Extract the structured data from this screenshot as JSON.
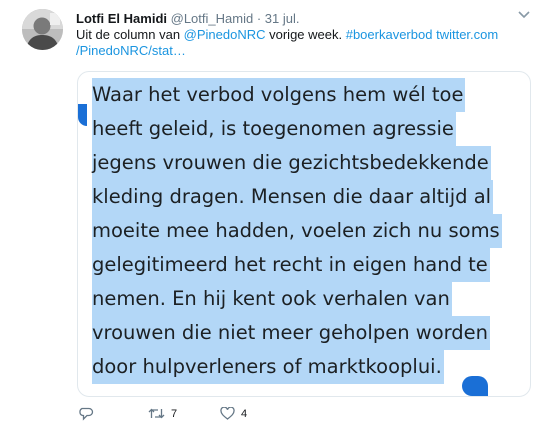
{
  "tweet": {
    "author_name": "Lotfi El Hamidi",
    "author_handle": "@Lotfi_Hamid",
    "separator": "·",
    "date": "31 jul.",
    "text_prefix": "Uit de column van ",
    "mention": "@PinedoNRC",
    "text_middle": " vorige week. ",
    "hashtag": "#boerkaverbod",
    "url_line1": "twitter.com",
    "url_line2": "/PinedoNRC/stat…"
  },
  "card": {
    "lines": [
      "Waar het verbod volgens hem wél toe",
      "heeft geleid, is toegenomen agressie",
      "jegens vrouwen die gezichtsbedekkende",
      "kleding dragen. Mensen die daar altijd al",
      "moeite mee hadden, voelen zich nu soms",
      "gelegitimeerd het recht in eigen hand te",
      "nemen. En hij kent ook verhalen van",
      "vrouwen die niet meer geholpen worden",
      "door hulpverleners of marktkooplui."
    ],
    "highlight_color": "#b3d7f7",
    "marker_color": "#1a6fd6"
  },
  "actions": {
    "retweet_count": "7",
    "like_count": "4"
  },
  "icons": {
    "avatar": "avatar-photo",
    "caret": "chevron-down-icon",
    "reply": "reply-icon",
    "retweet": "retweet-icon",
    "like": "heart-icon"
  },
  "colors": {
    "link": "#1b95e0",
    "muted": "#657786"
  }
}
